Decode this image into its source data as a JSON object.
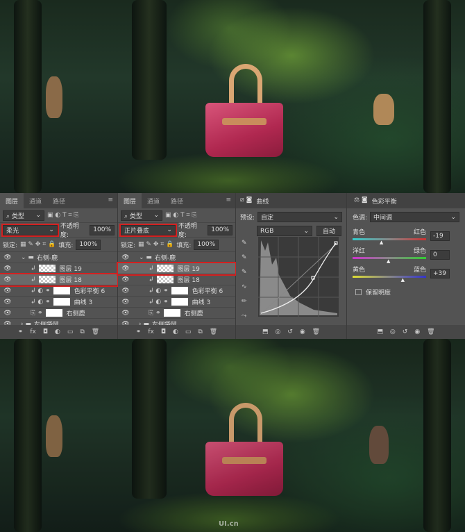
{
  "layers_panel_a": {
    "tabs": [
      "图层",
      "通道",
      "路径"
    ],
    "filter": "类型",
    "blend_mode": "柔光",
    "opacity_label": "不透明度:",
    "opacity": "100%",
    "lock_label": "锁定:",
    "fill_label": "填充:",
    "fill": "100%",
    "layers": [
      {
        "name": "右侧-鹿",
        "type": "group"
      },
      {
        "name": "图层 19",
        "type": "pixel"
      },
      {
        "name": "图层 18",
        "type": "pixel",
        "selected": true
      },
      {
        "name": "色彩平衡 6",
        "type": "adjustment"
      },
      {
        "name": "曲线 3",
        "type": "adjustment"
      },
      {
        "name": "右侧鹿",
        "type": "smart"
      },
      {
        "name": "左侧袋鼠",
        "type": "group"
      }
    ]
  },
  "layers_panel_b": {
    "tabs": [
      "图层",
      "通道",
      "路径"
    ],
    "filter": "类型",
    "blend_mode": "正片叠底",
    "opacity_label": "不透明度:",
    "opacity": "100%",
    "lock_label": "锁定:",
    "fill_label": "填充:",
    "fill": "100%",
    "layers": [
      {
        "name": "右侧-鹿",
        "type": "group"
      },
      {
        "name": "图层 19",
        "type": "pixel",
        "selected": true
      },
      {
        "name": "图层 18",
        "type": "pixel"
      },
      {
        "name": "色彩平衡 6",
        "type": "adjustment"
      },
      {
        "name": "曲线 3",
        "type": "adjustment"
      },
      {
        "name": "右侧鹿",
        "type": "smart"
      },
      {
        "name": "左侧袋鼠",
        "type": "group"
      }
    ]
  },
  "curves": {
    "title": "曲线",
    "preset_label": "预设:",
    "preset": "自定",
    "channel": "RGB",
    "auto_label": "自动"
  },
  "color_balance": {
    "title": "色彩平衡",
    "tone_label": "色调:",
    "tone": "中间调",
    "sliders": [
      {
        "left": "青色",
        "right": "红色",
        "value": "-19",
        "level": -19,
        "colors": [
          "#3cc",
          "#c33"
        ]
      },
      {
        "left": "洋红",
        "right": "绿色",
        "value": "0",
        "level": 0,
        "colors": [
          "#c3c",
          "#3c3"
        ]
      },
      {
        "left": "黄色",
        "right": "蓝色",
        "value": "+39",
        "level": 39,
        "colors": [
          "#dd3",
          "#33c"
        ]
      }
    ],
    "preserve_label": "保留明度"
  },
  "watermark": "UI.cn"
}
